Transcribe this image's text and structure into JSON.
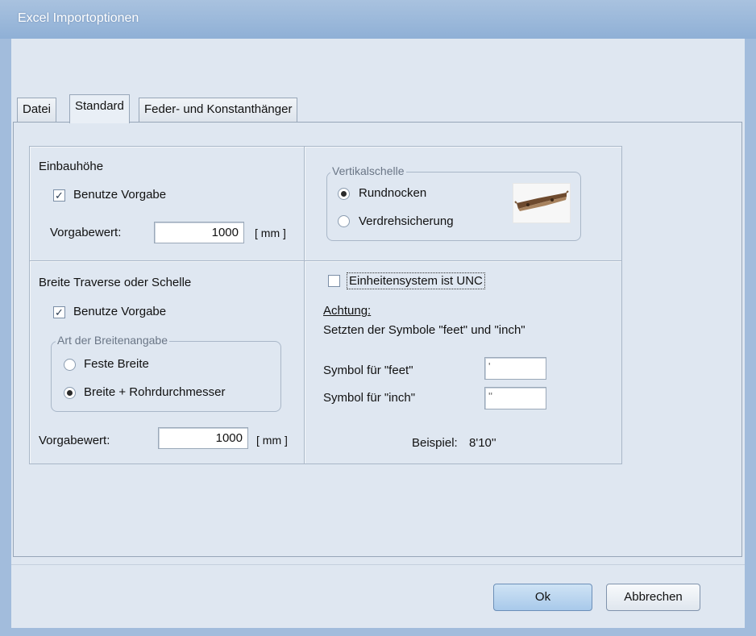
{
  "window": {
    "title": "Excel Importoptionen"
  },
  "tabs": [
    {
      "label": "Datei"
    },
    {
      "label": "Standard"
    },
    {
      "label": "Feder- und Konstanthänger"
    }
  ],
  "einbauhoehe": {
    "title": "Einbauhöhe",
    "use_default_label": "Benutze Vorgabe",
    "use_default_checked": true,
    "value_label": "Vorgabewert:",
    "value": "1000",
    "unit": "[ mm ]"
  },
  "vertikalschelle": {
    "legend": "Vertikalschelle",
    "options": [
      {
        "label": "Rundnocken",
        "selected": true
      },
      {
        "label": "Verdrehsicherung",
        "selected": false
      }
    ]
  },
  "breite": {
    "title": "Breite Traverse oder Schelle",
    "use_default_label": "Benutze Vorgabe",
    "use_default_checked": true,
    "art_legend": "Art der Breitenangabe",
    "options": [
      {
        "label": "Feste Breite",
        "selected": false
      },
      {
        "label": "Breite + Rohrdurchmesser",
        "selected": true
      }
    ],
    "value_label": "Vorgabewert:",
    "value": "1000",
    "unit": "[ mm ]"
  },
  "units": {
    "unc_label": "Einheitensystem ist UNC",
    "unc_checked": false,
    "achtung": "Achtung:",
    "note": "Setzten der Symbole \"feet\" und \"inch\"",
    "feet_label": "Symbol für \"feet\"",
    "feet_value": "'",
    "inch_label": "Symbol für \"inch\"",
    "inch_value": "''",
    "example_label": "Beispiel:",
    "example_value": "8'10''"
  },
  "buttons": {
    "ok": "Ok",
    "cancel": "Abbrechen"
  },
  "icons": {
    "check": "checkmark-icon",
    "pipe_clamp": "pipe-clamp-icon"
  }
}
